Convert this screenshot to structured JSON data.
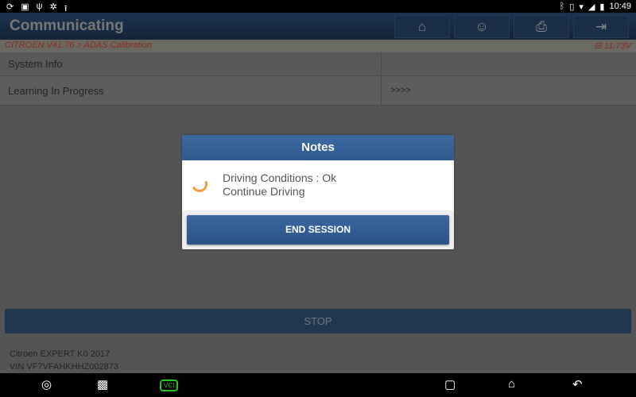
{
  "status_bar": {
    "left_icons": [
      "sync-icon",
      "gallery-icon",
      "usb-icon",
      "settings-icon",
      "upload-icon"
    ],
    "right_icons": [
      "bluetooth-icon",
      "vibrate-icon",
      "wifi-icon",
      "signal-icon",
      "battery-icon"
    ],
    "time": "10:49"
  },
  "header": {
    "title": "Communicating",
    "buttons": [
      "home-icon",
      "support-icon",
      "print-icon",
      "exit-icon"
    ]
  },
  "breadcrumb": {
    "path": "CITROEN V41.76 > ADAS Calibration",
    "voltage": "11.73V"
  },
  "table": {
    "rows": [
      {
        "label": "System Info",
        "value": ""
      },
      {
        "label": "Learning In Progress",
        "value": ">>>>"
      }
    ]
  },
  "stop_label": "STOP",
  "vehicle": {
    "model": "Citroen EXPERT K0 2017",
    "vin": "VIN VF7VFAHKHHZ002873"
  },
  "dialog": {
    "title": "Notes",
    "line1": "Driving Conditions : Ok",
    "line2": "Continue Driving",
    "button": "END SESSION"
  },
  "nav_bar": {
    "vci_label": "VCI",
    "icons": [
      "browser-icon",
      "gallery-icon",
      "vci-icon",
      "recents-icon",
      "home-icon",
      "back-icon"
    ]
  },
  "colors": {
    "header": "#16263c",
    "accent": "#2e5a8f",
    "spinner": "#f39a3c",
    "breadcrumb_text": "#8e2a20",
    "vci": "#22c322"
  }
}
